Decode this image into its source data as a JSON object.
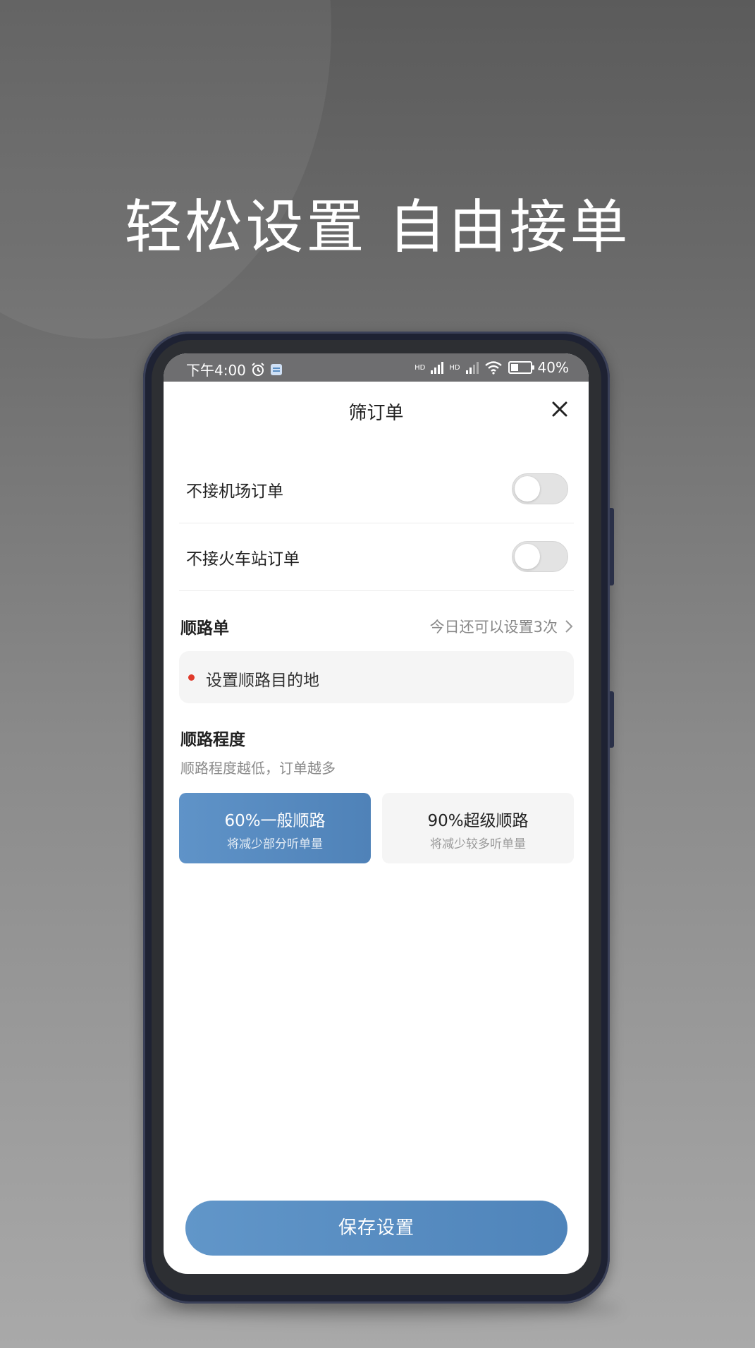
{
  "promo": {
    "headline": "轻松设置 自由接单"
  },
  "status_bar": {
    "time": "下午4:00",
    "network_1": "HD",
    "network_2": "HD",
    "battery": "40%",
    "icons": [
      "alarm-clock-icon",
      "app-notification-icon",
      "signal-icon",
      "wifi-icon",
      "battery-icon"
    ]
  },
  "dialog": {
    "title": "筛订单",
    "close_icon": "close-icon"
  },
  "filters": {
    "airport_label": "不接机场订单",
    "airport_enabled": false,
    "train_station_label": "不接火车站订单",
    "train_station_enabled": false
  },
  "route_order": {
    "title": "顺路单",
    "remaining_text": "今日还可以设置3次",
    "destination_placeholder": "设置顺路目的地"
  },
  "route_level": {
    "title": "顺路程度",
    "hint": "顺路程度越低，订单越多",
    "options": [
      {
        "label": "60%一般顺路",
        "sub": "将减少部分听单量",
        "selected": true
      },
      {
        "label": "90%超级顺路",
        "sub": "将减少较多听单量",
        "selected": false
      }
    ]
  },
  "actions": {
    "save_label": "保存设置"
  },
  "colors": {
    "accent": "#5a8ec3",
    "dot_red": "#e03a2b",
    "status_bar": "#6e6e70"
  }
}
